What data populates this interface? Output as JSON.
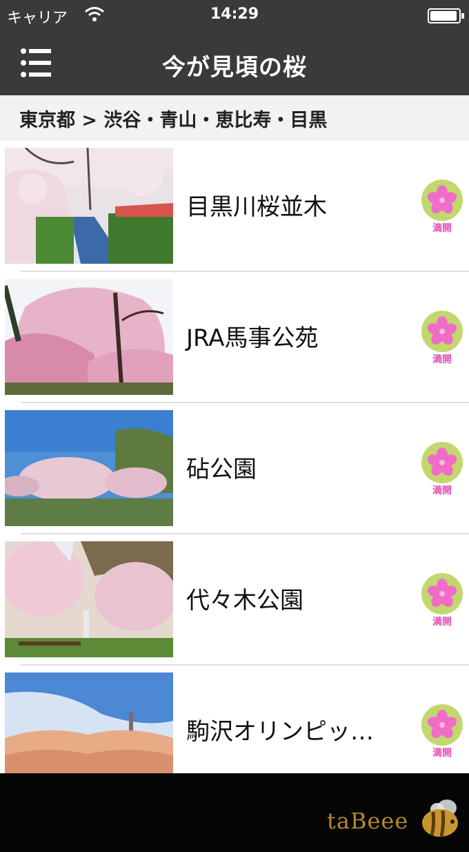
{
  "status_bar": {
    "carrier": "キャリア",
    "time": "14:29",
    "battery_level": 1.0
  },
  "header": {
    "title": "今が見頃の桜",
    "menu_icon": "list-menu-icon"
  },
  "breadcrumb": {
    "text": "東京都 > 渋谷・青山・恵比寿・目黒"
  },
  "spots": [
    {
      "name": "目黒川桜並木",
      "status": "満開",
      "photo": "canal-cherry-blossoms"
    },
    {
      "name": "JRA馬事公苑",
      "status": "満開",
      "photo": "weeping-cherry-trees"
    },
    {
      "name": "砧公園",
      "status": "満開",
      "photo": "park-field-cherry"
    },
    {
      "name": "代々木公園",
      "status": "満開",
      "photo": "park-fountain-cherry"
    },
    {
      "name": "駒沢オリンピッ…",
      "status": "満開",
      "photo": "tower-cherry-row"
    }
  ],
  "footer": {
    "brand": "taBeee",
    "logo_icon": "bee-icon"
  },
  "colors": {
    "bar": "#3a3a3a",
    "status_circle": "#c2d86f",
    "status_flower": "#f06cc8",
    "brand": "#b48a2e"
  }
}
